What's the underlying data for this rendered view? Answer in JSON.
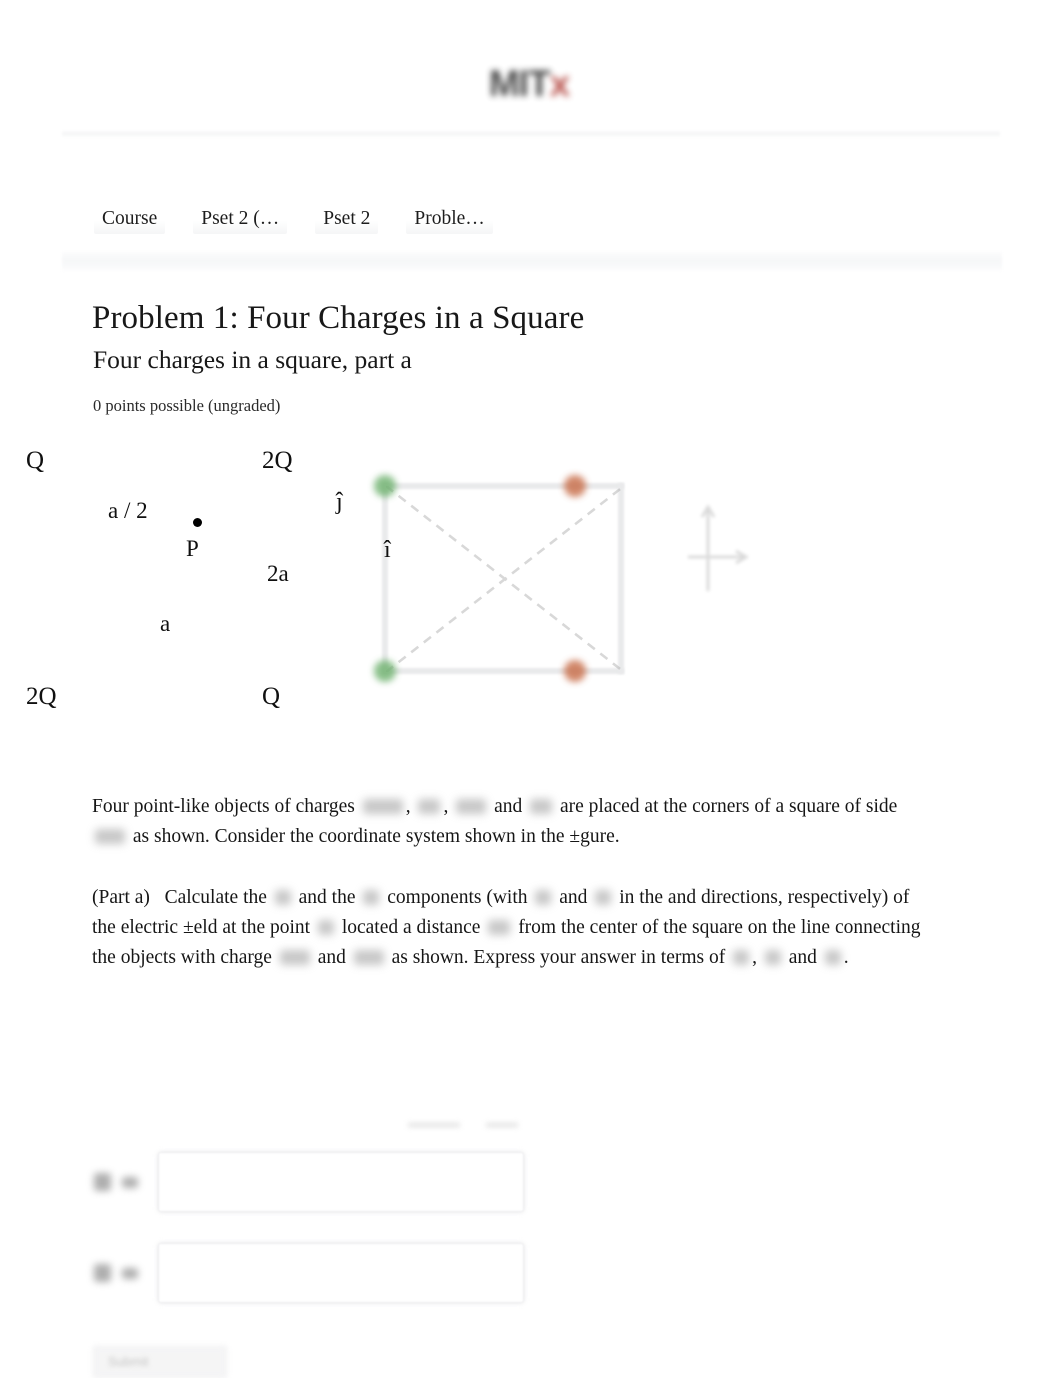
{
  "header": {
    "logo_text": "MIT",
    "logo_accent": "x",
    "logo_accent_color": "#b44a44"
  },
  "breadcrumb": {
    "items": [
      {
        "label": "Course"
      },
      {
        "label": "Pset 2 (…"
      },
      {
        "label": "Pset 2"
      },
      {
        "label": "Proble…"
      }
    ]
  },
  "problem": {
    "title": "Problem 1: Four Charges in a Square",
    "subtitle": "Four charges in a square, part a",
    "points_note": "0 points possible (ungraded)"
  },
  "figure": {
    "caption_labels": {
      "top_left_charge": "Q",
      "top_right_charge": "2Q",
      "bottom_left_charge": "2Q",
      "bottom_right_charge": "Q",
      "half_side": "a / 2",
      "point": "P",
      "right_side": "2a",
      "diagonal": "a",
      "unit_vector_y": "ĵ",
      "unit_vector_x": "î"
    },
    "colors": {
      "green_charge": "#74b474",
      "orange_charge": "#c9724f",
      "square_line": "#e9eaeb"
    }
  },
  "body": {
    "paragraph_1": {
      "seg_1": "Four point-like objects of charges",
      "seg_2": ",",
      "seg_3": ",",
      "seg_4": "and",
      "seg_5": "are placed at the corners of a square of side",
      "seg_6": "as shown. Consider the coordinate system shown in the ±gure."
    },
    "paragraph_2": {
      "seg_1": "(Part a)",
      "seg_2": "Calculate the",
      "seg_3": "and the",
      "seg_4": "components (with",
      "seg_5": "and",
      "seg_6": "in  the  and  directions, respectively) of the electric ±eld at the point",
      "seg_7": "located a distance",
      "seg_8": "from the center of the square on the line connecting the objects with charge",
      "seg_9": "and",
      "seg_10": "as shown. Express your answer in terms of",
      "seg_11": ",",
      "seg_12": "and",
      "seg_13": "."
    }
  },
  "answers": {
    "rows": [
      {
        "name": "answer-row-1"
      },
      {
        "name": "answer-row-2"
      }
    ],
    "input_value": "",
    "input_placeholder": ""
  },
  "footer": {
    "submit_label": "Submit"
  }
}
